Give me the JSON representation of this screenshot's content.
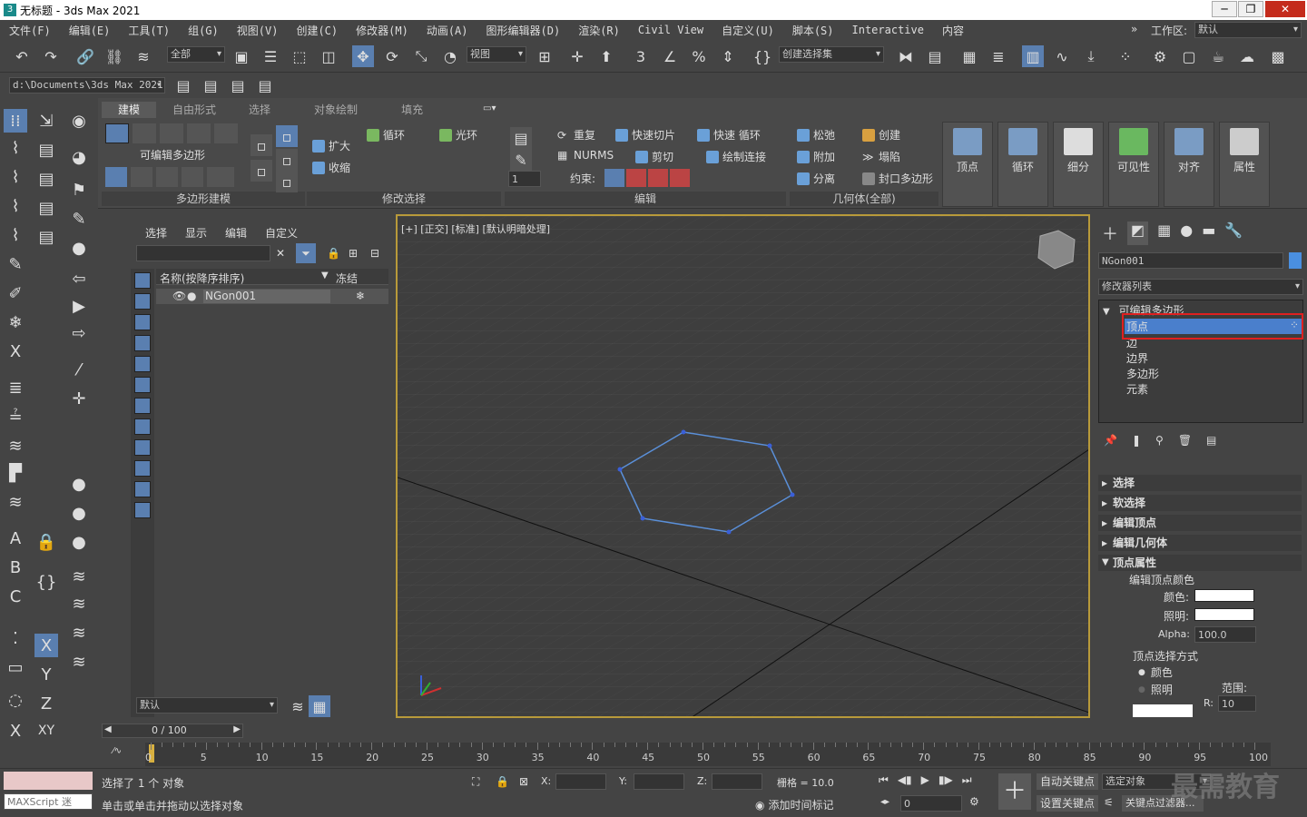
{
  "window": {
    "title": "无标题 - 3ds Max 2021",
    "logo": "3",
    "min": "─",
    "max": "❐",
    "close": "✕"
  },
  "menu": [
    "文件(F)",
    "编辑(E)",
    "工具(T)",
    "组(G)",
    "视图(V)",
    "创建(C)",
    "修改器(M)",
    "动画(A)",
    "图形编辑器(D)",
    "渲染(R)",
    "Civil View",
    "自定义(U)",
    "脚本(S)",
    "Interactive",
    "内容"
  ],
  "workspace": {
    "label": "工作区:",
    "value": "默认"
  },
  "toolbar": {
    "filter": "全部",
    "refcoord": "视图",
    "selset": "创建选择集",
    "path": "d:\\Documents\\3ds Max 2021"
  },
  "ribbon": {
    "tabs": [
      "建模",
      "自由形式",
      "选择",
      "对象绘制",
      "填充"
    ],
    "active_tab": "建模",
    "groups": [
      "多边形建模",
      "修改选择",
      "编辑",
      "几何体(全部)"
    ],
    "poly_label": "可编辑多边形",
    "modsel": {
      "grow": "扩大",
      "shrink": "收缩",
      "loop": "循环",
      "ring": "光环"
    },
    "edit": {
      "repeat": "重复",
      "quickslice": "快速切片",
      "quickloop": "快速 循环",
      "nurms": "NURMS",
      "cut": "剪切",
      "pconnect": "绘制连接",
      "constraint": "约束:",
      "num": "1"
    },
    "geom": {
      "relax": "松弛",
      "create": "创建",
      "attach": "附加",
      "collapse": "塌陷",
      "detach": "分离",
      "cap": "封口多边形"
    },
    "big": [
      "顶点",
      "循环",
      "细分",
      "可见性",
      "对齐",
      "属性"
    ]
  },
  "scene": {
    "menu": [
      "选择",
      "显示",
      "编辑",
      "自定义"
    ],
    "col_name": "名称(按降序排序)",
    "col_freeze": "冻结",
    "object": "NGon001",
    "layer": "默认"
  },
  "viewport": {
    "label": "[+] [正交] [标准] [默认明暗处理]"
  },
  "cmd": {
    "objname": "NGon001",
    "modlist": "修改器列表",
    "stack_top": "可编辑多边形",
    "stack_items": [
      "顶点",
      "边",
      "边界",
      "多边形",
      "元素"
    ],
    "selected": "顶点",
    "rollouts": [
      "选择",
      "软选择",
      "编辑顶点",
      "编辑几何体"
    ],
    "open_rollout": "顶点属性",
    "vcolor": {
      "title": "编辑顶点颜色",
      "color": "颜色:",
      "illum": "照明:",
      "alpha": "Alpha:",
      "alpha_val": "100.0"
    },
    "vsel": {
      "title": "顶点选择方式",
      "opt1": "颜色",
      "opt2": "照明",
      "range": "范围:",
      "r": "R:",
      "rval": "10"
    }
  },
  "timeline": {
    "frame": "0 / 100",
    "ticks": [
      "0",
      "5",
      "10",
      "15",
      "20",
      "25",
      "30",
      "35",
      "40",
      "45",
      "50",
      "55",
      "60",
      "65",
      "70",
      "75",
      "80",
      "85",
      "90",
      "95",
      "100"
    ]
  },
  "status": {
    "selected": "选择了 1 个 对象",
    "prompt": "单击或单击并拖动以选择对象",
    "maxscript": "MAXScript 迷",
    "x": "X:",
    "y": "Y:",
    "z": "Z:",
    "grid": "栅格 = 10.0",
    "addtime": "添加时间标记",
    "autokey": "自动关键点",
    "selobj": "选定对象",
    "setkey": "设置关键点",
    "keyfilter": "关键点过滤器...",
    "frame": "0",
    "watermark": "最需教育"
  },
  "colors": {
    "accent": "#5a8fd8",
    "selected": "#4a7fcc",
    "highlight_red": "#e02020",
    "viewport_border": "#b89a3a"
  }
}
